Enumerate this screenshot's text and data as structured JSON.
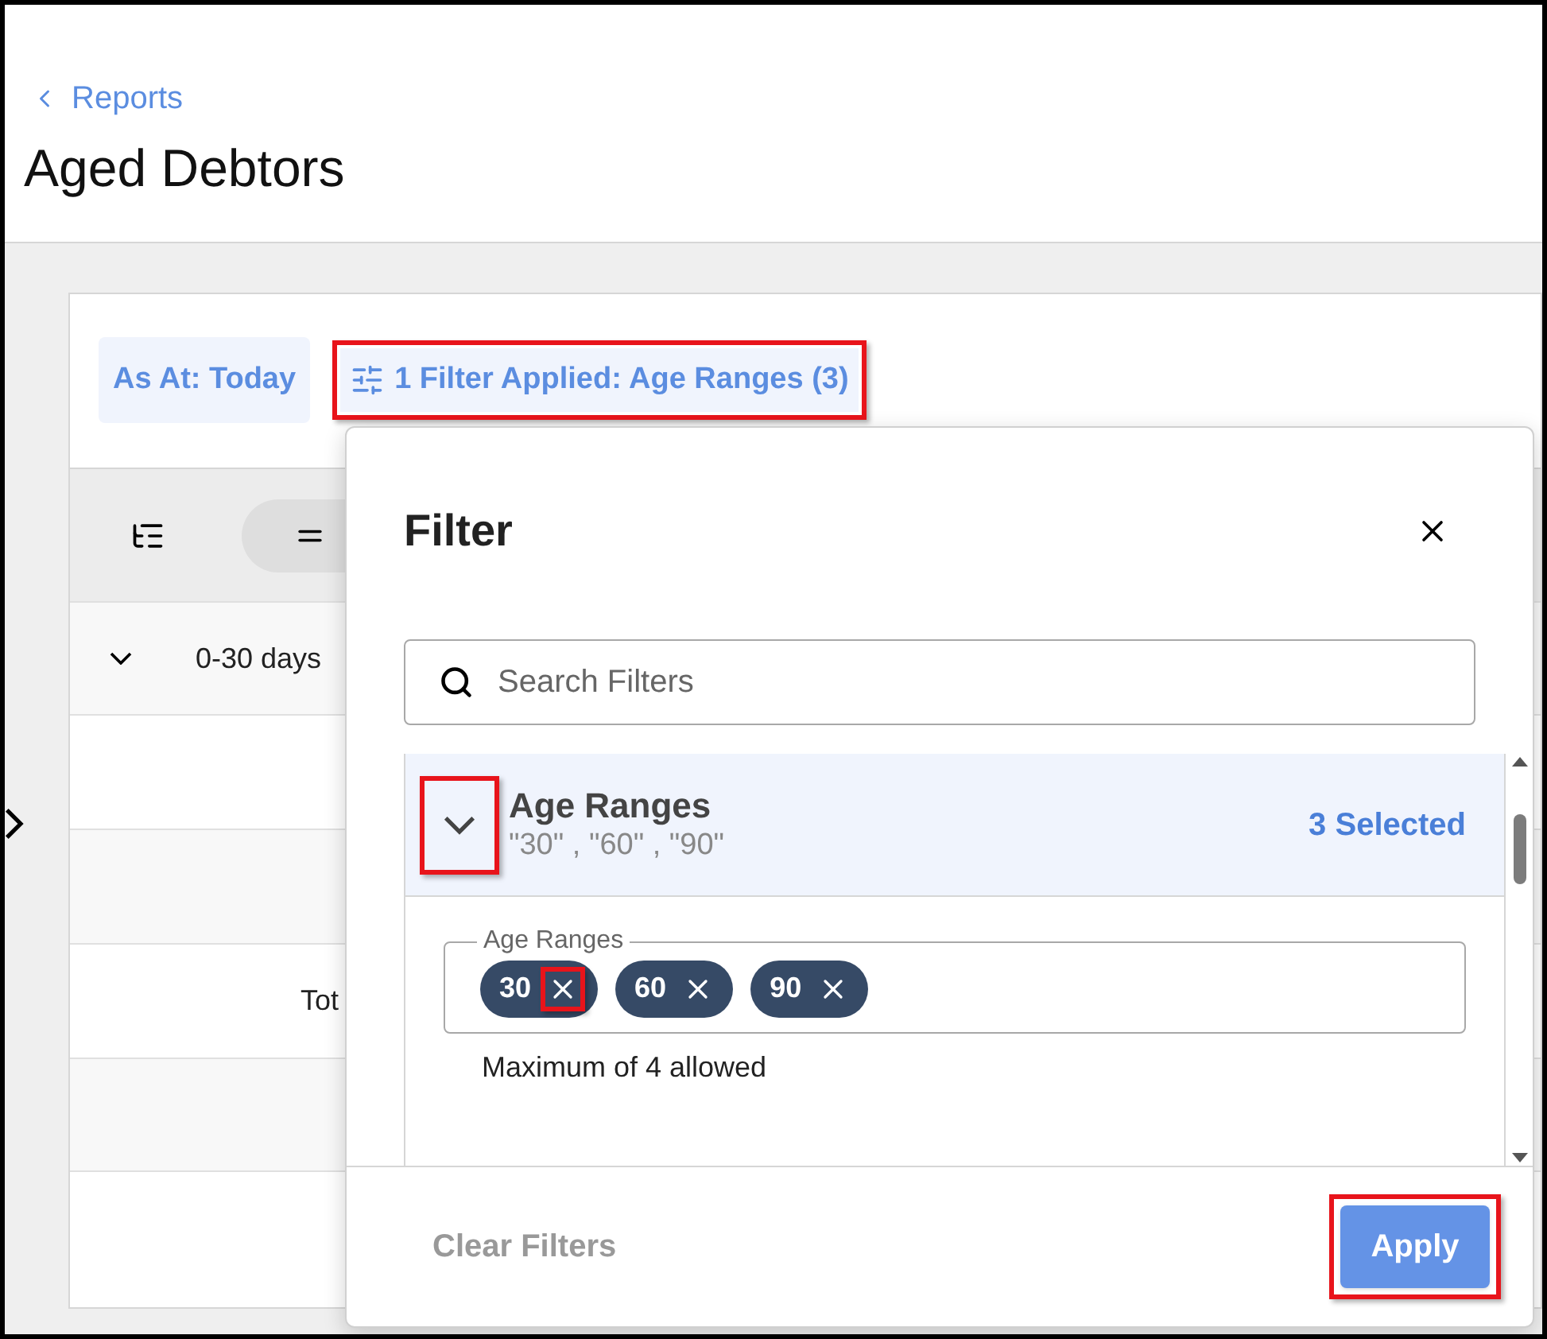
{
  "breadcrumb": {
    "label": "Reports"
  },
  "page_title": "Aged Debtors",
  "toolbar": {
    "as_at": "As At: Today",
    "filter_button": {
      "label": "1 Filter Applied: Age Ranges (3)",
      "highlighted": true
    }
  },
  "table": {
    "rows": [
      {
        "kind": "header"
      },
      {
        "kind": "group",
        "label": "0-30 days",
        "expanded": true
      },
      {
        "kind": "blank"
      },
      {
        "kind": "blank"
      },
      {
        "kind": "total",
        "label": "Tot"
      },
      {
        "kind": "blank"
      }
    ]
  },
  "filter_panel": {
    "title": "Filter",
    "search": {
      "placeholder": "Search Filters"
    },
    "sections": [
      {
        "title": "Age Ranges",
        "summary": "\"30\" , \"60\" , \"90\"",
        "count": "3 Selected",
        "expanded": true,
        "toggle_highlighted": true,
        "field": {
          "label": "Age Ranges",
          "chips": [
            {
              "label": "30",
              "remove_highlighted": true
            },
            {
              "label": "60",
              "remove_highlighted": false
            },
            {
              "label": "90",
              "remove_highlighted": false
            }
          ],
          "helper": "Maximum of 4 allowed"
        }
      }
    ],
    "footer": {
      "clear": "Clear Filters",
      "apply": {
        "label": "Apply",
        "highlighted": true
      }
    }
  }
}
